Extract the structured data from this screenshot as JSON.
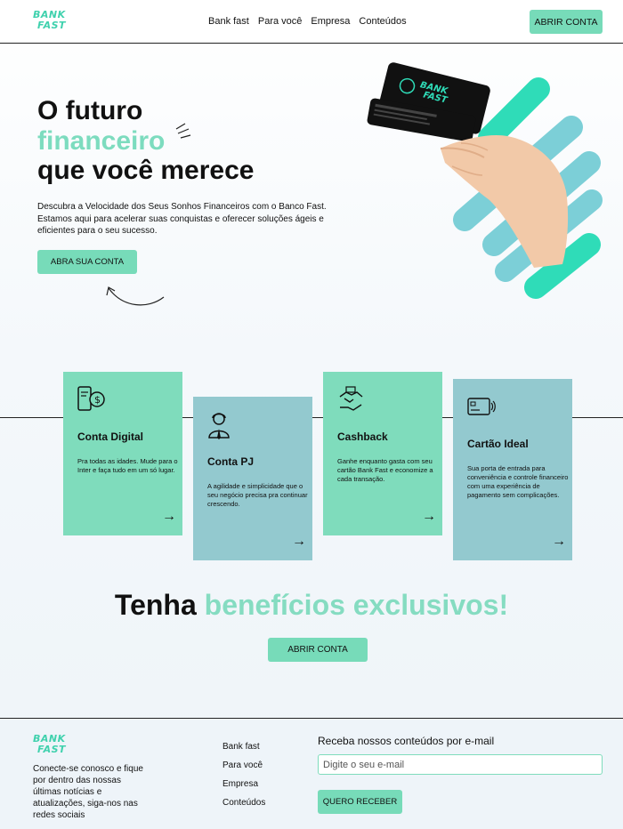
{
  "brand": {
    "line1": "BANK",
    "line2": "FAST"
  },
  "header": {
    "nav": [
      "Bank fast",
      "Para você",
      "Empresa",
      "Conteúdos"
    ],
    "cta_label": "ABRIR CONTA"
  },
  "hero": {
    "title_line1": "O futuro",
    "title_accent": "financeiro",
    "title_line3": "que você merece",
    "description": "Descubra a Velocidade dos Seus Sonhos Financeiros com o Banco Fast. Estamos aqui para acelerar suas conquistas e oferecer soluções ágeis e eficientes para o seu sucesso.",
    "cta_label": "ABRA SUA CONTA",
    "card_brand_line1": "BANK",
    "card_brand_line2": "FAST"
  },
  "cards": [
    {
      "title": "Conta Digital",
      "text": "Pra todas as idades. Mude para o Inter e faça tudo em um só lugar.",
      "icon": "mobile-payment-icon",
      "arrow": "→"
    },
    {
      "title": "Conta PJ",
      "text": "A agilidade e simplicidade que o seu negócio precisa pra continuar crescendo.",
      "icon": "business-person-icon",
      "arrow": "→"
    },
    {
      "title": "Cashback",
      "text": "Ganhe enquanto gasta com seu cartão Bank Fast e economize a cada transação.",
      "icon": "handshake-money-icon",
      "arrow": "→"
    },
    {
      "title": "Cartão Ideal",
      "text": "Sua porta de entrada para conveniência e controle financeiro com uma experiência de pagamento sem complicações.",
      "icon": "contactless-card-icon",
      "arrow": "→"
    }
  ],
  "benefits": {
    "title_plain": "Tenha ",
    "title_accent": "benefícios exclusivos!",
    "cta_label": "ABRIR CONTA"
  },
  "footer": {
    "text": "Conecte-se conosco e fique por dentro das nossas últimas notícias e atualizações, siga-nos nas redes sociais",
    "links": [
      "Bank fast",
      "Para você",
      "Empresa",
      "Conteúdos"
    ],
    "newsletter_title": "Receba nossos conteúdos por e-mail",
    "email_placeholder": "Digite o seu e-mail",
    "subscribe_label": "QUERO RECEBER"
  },
  "colors": {
    "accent": "#7fdcbc",
    "blue_card": "#93c9cf",
    "mint": "#2fdcb8",
    "teal": "#7ccfd7"
  }
}
